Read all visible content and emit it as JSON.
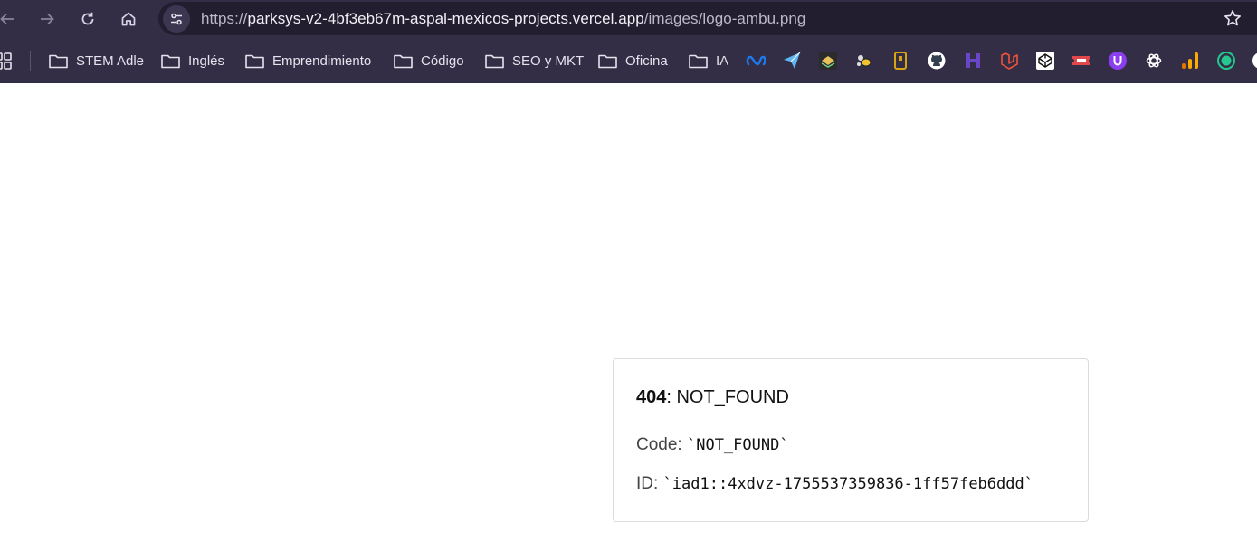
{
  "browser": {
    "url_scheme": "https://",
    "url_host": "parksys-v2-4bf3eb67m-aspal-mexicos-projects.vercel.app",
    "url_path": "/images/logo-ambu.png"
  },
  "bookmarks": {
    "folders": [
      "STEM Adle",
      "Inglés",
      "Emprendimiento",
      "Código",
      "SEO y MKT",
      "Oficina",
      "IA"
    ],
    "extension_icons": [
      "meta-icon",
      "paper-plane-icon",
      "layers-icon",
      "bee-icon",
      "tag-icon",
      "github-icon",
      "h-icon",
      "laravel-icon",
      "codepen-icon",
      "ticket-icon",
      "u-icon",
      "openai-icon",
      "analytics-icon",
      "ec-icon"
    ]
  },
  "error": {
    "status_code": "404",
    "status_text": ": NOT_FOUND",
    "code_label": "Code: ",
    "code_value": "`NOT_FOUND`",
    "id_label": "ID: ",
    "id_value": "`iad1::4xdvz-1755537359836-1ff57feb6ddd`"
  },
  "colors": {
    "toolbar_bg": "#332e45",
    "omnibox_bg": "#221e2f",
    "card_border": "#dcdcdc"
  }
}
